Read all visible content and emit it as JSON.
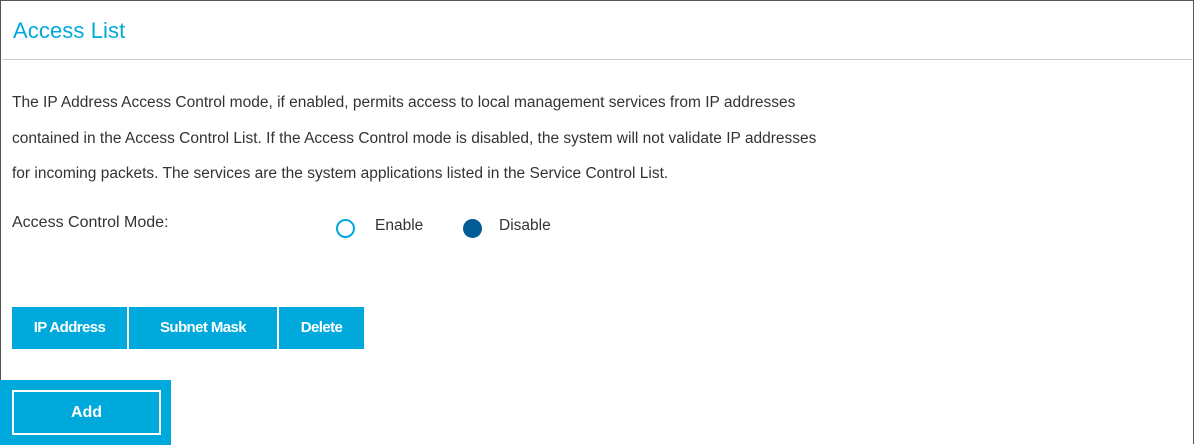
{
  "section": {
    "title": "Access List",
    "description_lines": [
      "The IP Address Access Control mode, if enabled, permits access to local management services from IP addresses",
      "contained in the Access Control List. If the Access Control mode is disabled, the system will not validate IP addresses",
      "for incoming packets. The services are the system applications listed in the Service Control List."
    ]
  },
  "access_control_mode": {
    "label": "Access Control Mode:",
    "options": [
      {
        "label": "Enable",
        "selected": false
      },
      {
        "label": "Disable",
        "selected": true
      }
    ]
  },
  "table": {
    "columns": [
      "IP Address",
      "Subnet Mask",
      "Delete"
    ],
    "rows": []
  },
  "actions": {
    "add_label": "Add"
  },
  "colors": {
    "accent": "#00a9dc",
    "selected_radio": "#005b96",
    "text": "#333333"
  }
}
